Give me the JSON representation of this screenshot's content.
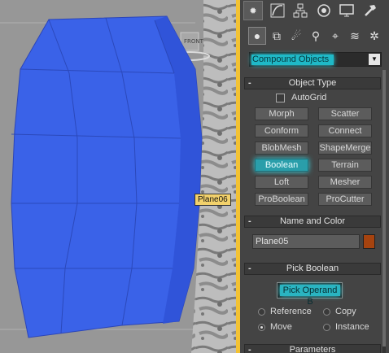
{
  "viewport": {
    "viewcube_label": "FRONT",
    "object_label": "Plane06"
  },
  "command_panel": {
    "tabs": [
      {
        "name": "create-tab",
        "icon": "sun-icon"
      },
      {
        "name": "modify-tab",
        "icon": "modify-curve-icon"
      },
      {
        "name": "hierarchy-tab",
        "icon": "hierarchy-icon"
      },
      {
        "name": "motion-tab",
        "icon": "motion-icon"
      },
      {
        "name": "display-tab",
        "icon": "monitor-icon"
      },
      {
        "name": "utilities-tab",
        "icon": "hammer-icon"
      }
    ],
    "subtabs": [
      {
        "name": "geometry",
        "icon": "sphere-icon"
      },
      {
        "name": "shapes",
        "icon": "shapes-icon"
      },
      {
        "name": "lights",
        "icon": "light-icon"
      },
      {
        "name": "cameras",
        "icon": "camera-icon"
      },
      {
        "name": "helpers",
        "icon": "helper-icon"
      },
      {
        "name": "space-warps",
        "icon": "wave-icon"
      },
      {
        "name": "systems",
        "icon": "gear-icon"
      }
    ],
    "category_dropdown": "Compound Objects",
    "object_type": {
      "title": "Object Type",
      "autogrid_label": "AutoGrid",
      "buttons": [
        "Morph",
        "Scatter",
        "Conform",
        "Connect",
        "BlobMesh",
        "ShapeMerge",
        "Boolean",
        "Terrain",
        "Loft",
        "Mesher",
        "ProBoolean",
        "ProCutter"
      ]
    },
    "name_and_color": {
      "title": "Name and Color",
      "name_value": "Plane05",
      "color": "#a6430f"
    },
    "pick_boolean": {
      "title": "Pick Boolean",
      "pick_button": "Pick Operand B",
      "options": [
        "Reference",
        "Copy",
        "Move",
        "Instance"
      ],
      "selected": "Move"
    },
    "parameters_title": "Parameters"
  },
  "colors": {
    "accent_highlight": "#2ab4c1",
    "viewport_border": "#f3c233",
    "object_blue": "#3a62e8"
  }
}
